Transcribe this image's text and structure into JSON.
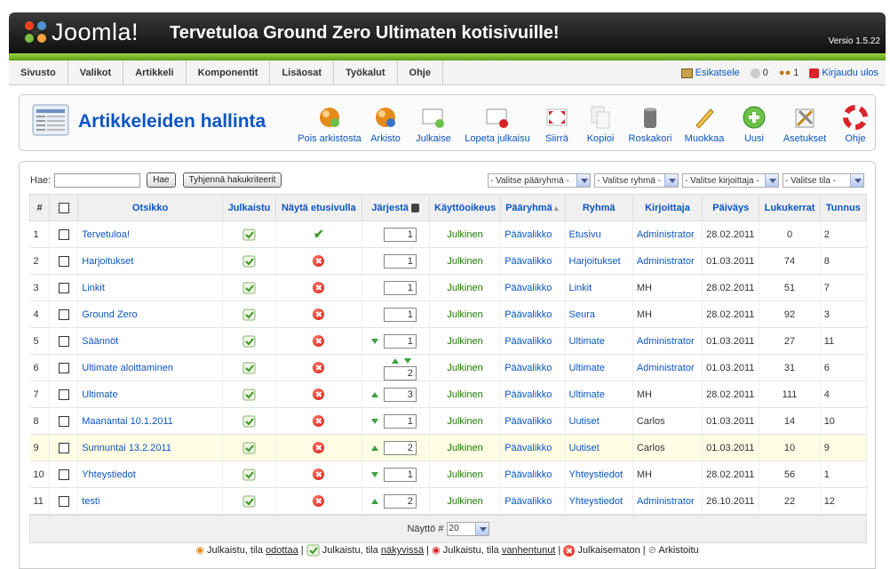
{
  "header": {
    "logo": "Joomla!",
    "title": "Tervetuloa Ground Zero Ultimaten kotisivuille!",
    "version": "Versio 1.5.22"
  },
  "menu": [
    "Sivusto",
    "Valikot",
    "Artikkeli",
    "Komponentit",
    "Lisäosat",
    "Työkalut",
    "Ohje"
  ],
  "status": {
    "preview": "Esikatsele",
    "messages": "0",
    "users": "1",
    "logout": "Kirjaudu ulos"
  },
  "toolbar": {
    "title": "Artikkeleiden hallinta",
    "buttons": [
      "Pois arkistosta",
      "Arkisto",
      "Julkaise",
      "Lopeta julkaisu",
      "Siirrä",
      "Kopioi",
      "Roskakori",
      "Muokkaa",
      "Uusi",
      "Asetukset",
      "Ohje"
    ]
  },
  "filter": {
    "label": "Hae:",
    "search_value": "",
    "go": "Hae",
    "reset": "Tyhjennä hakukriteerit"
  },
  "selects": [
    "- Valitse pääryhmä -",
    "- Valitse ryhmä -",
    "- Valitse kirjoittaja -",
    "- Valitse tila -"
  ],
  "columns": [
    "#",
    "",
    "Otsikko",
    "Julkaistu",
    "Näytä etusivulla",
    "Järjestä",
    "Käyttöoikeus",
    "Pääryhmä",
    "Ryhmä",
    "Kirjoittaja",
    "Päiväys",
    "Lukukerrat",
    "Tunnus"
  ],
  "rows": [
    {
      "n": "1",
      "title": "Tervetuloa!",
      "front": "yes",
      "up": false,
      "down": false,
      "order": "1",
      "access": "Julkinen",
      "section": "Päävalikko",
      "category": "Etusivu",
      "author": "Administrator",
      "date": "28.02.2011",
      "hits": "0",
      "id": "2"
    },
    {
      "n": "2",
      "title": "Harjoitukset",
      "front": "no",
      "up": false,
      "down": false,
      "order": "1",
      "access": "Julkinen",
      "section": "Päävalikko",
      "category": "Harjoitukset",
      "author": "Administrator",
      "date": "01.03.2011",
      "hits": "74",
      "id": "8"
    },
    {
      "n": "3",
      "title": "Linkit",
      "front": "no",
      "up": false,
      "down": false,
      "order": "1",
      "access": "Julkinen",
      "section": "Päävalikko",
      "category": "Linkit",
      "author": "MH",
      "date": "28.02.2011",
      "hits": "51",
      "id": "7"
    },
    {
      "n": "4",
      "title": "Ground Zero",
      "front": "no",
      "up": false,
      "down": false,
      "order": "1",
      "access": "Julkinen",
      "section": "Päävalikko",
      "category": "Seura",
      "author": "MH",
      "date": "28.02.2011",
      "hits": "92",
      "id": "3"
    },
    {
      "n": "5",
      "title": "Säännöt",
      "front": "no",
      "up": false,
      "down": true,
      "order": "1",
      "access": "Julkinen",
      "section": "Päävalikko",
      "category": "Ultimate",
      "author": "Administrator",
      "date": "01.03.2011",
      "hits": "27",
      "id": "11"
    },
    {
      "n": "6",
      "title": "Ultimate aloittaminen",
      "front": "no",
      "up": true,
      "down": true,
      "order": "2",
      "access": "Julkinen",
      "section": "Päävalikko",
      "category": "Ultimate",
      "author": "Administrator",
      "date": "01.03.2011",
      "hits": "31",
      "id": "6"
    },
    {
      "n": "7",
      "title": "Ultimate",
      "front": "no",
      "up": true,
      "down": false,
      "order": "3",
      "access": "Julkinen",
      "section": "Päävalikko",
      "category": "Ultimate",
      "author": "MH",
      "date": "28.02.2011",
      "hits": "111",
      "id": "4"
    },
    {
      "n": "8",
      "title": "Maanantai 10.1.2011",
      "front": "no",
      "up": false,
      "down": true,
      "order": "1",
      "access": "Julkinen",
      "section": "Päävalikko",
      "category": "Uutiset",
      "author": "Carlos",
      "date": "01.03.2011",
      "hits": "14",
      "id": "10"
    },
    {
      "n": "9",
      "title": "Sunnuntai 13.2.2011",
      "front": "no",
      "up": true,
      "down": false,
      "order": "2",
      "access": "Julkinen",
      "section": "Päävalikko",
      "category": "Uutiset",
      "author": "Carlos",
      "date": "01.03.2011",
      "hits": "10",
      "id": "9"
    },
    {
      "n": "10",
      "title": "Yhteystiedot",
      "front": "no",
      "up": false,
      "down": true,
      "order": "1",
      "access": "Julkinen",
      "section": "Päävalikko",
      "category": "Yhteystiedot",
      "author": "MH",
      "date": "28.02.2011",
      "hits": "56",
      "id": "1"
    },
    {
      "n": "11",
      "title": "testi",
      "front": "no",
      "up": true,
      "down": false,
      "order": "2",
      "access": "Julkinen",
      "section": "Päävalikko",
      "category": "Yhteystiedot",
      "author": "Administrator",
      "date": "26.10.2011",
      "hits": "22",
      "id": "12"
    }
  ],
  "pagination": {
    "label": "Näyttö #",
    "value": "20"
  },
  "legend": {
    "pending_pre": "Julkaistu, tila ",
    "pending": "odottaa",
    "current_pre": "Julkaistu, tila ",
    "current": "näkyvissä",
    "expired_pre": "Julkaistu, tila ",
    "expired": "vanhentunut",
    "unpublished": "Julkaisematon",
    "archived": "Arkistoitu"
  }
}
